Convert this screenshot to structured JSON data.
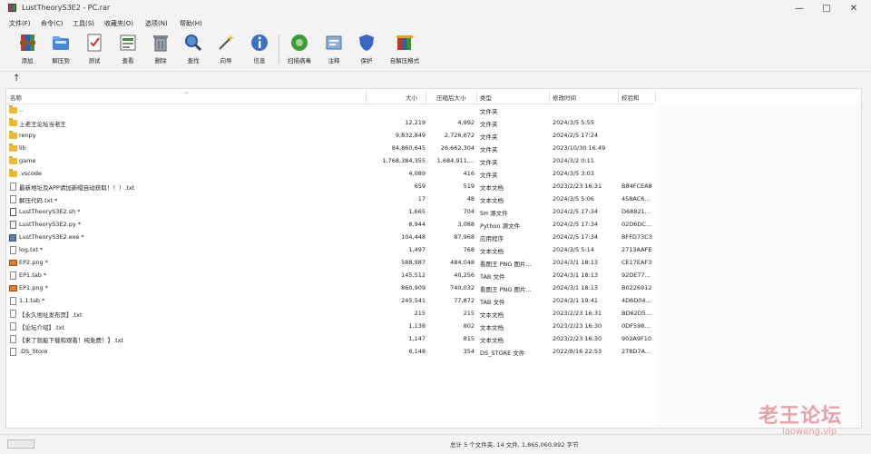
{
  "window": {
    "title": "LustTheoryS3E2 - PC.rar",
    "minimize": "—",
    "maximize": "□",
    "close": "✕"
  },
  "menu": [
    "文件(F)",
    "命令(C)",
    "工具(S)",
    "收藏夹(O)",
    "选项(N)",
    "帮助(H)"
  ],
  "toolbar": [
    {
      "label": "添加",
      "icon": "add-archive-icon"
    },
    {
      "label": "解压到",
      "icon": "extract-to-icon"
    },
    {
      "label": "测试",
      "icon": "test-icon"
    },
    {
      "label": "查看",
      "icon": "view-icon"
    },
    {
      "label": "删除",
      "icon": "delete-icon"
    },
    {
      "label": "查找",
      "icon": "find-icon"
    },
    {
      "label": "向导",
      "icon": "wizard-icon"
    },
    {
      "label": "信息",
      "icon": "info-icon"
    },
    {
      "label": "扫描病毒",
      "icon": "scan-virus-icon"
    },
    {
      "label": "注释",
      "icon": "comment-icon"
    },
    {
      "label": "保护",
      "icon": "protect-icon"
    },
    {
      "label": "自解压格式",
      "icon": "sfx-icon"
    }
  ],
  "address": {
    "up": "↑"
  },
  "columns": {
    "name": "名称",
    "size": "大小",
    "packed": "压缩后大小",
    "type": "类型",
    "modified": "修改时间",
    "crc": "校验和"
  },
  "files": [
    {
      "name": "..",
      "size": "",
      "packed": "",
      "type": "文件夹",
      "modified": "",
      "crc": "",
      "icon": "folder"
    },
    {
      "name": "上老王论坛当老王",
      "size": "12,219",
      "packed": "4,992",
      "type": "文件夹",
      "modified": "2024/3/5 5:55",
      "crc": "",
      "icon": "folder"
    },
    {
      "name": "renpy",
      "size": "9,832,849",
      "packed": "2,726,672",
      "type": "文件夹",
      "modified": "2024/2/5 17:24",
      "crc": "",
      "icon": "folder"
    },
    {
      "name": "lib",
      "size": "84,860,645",
      "packed": "26,662,304",
      "type": "文件夹",
      "modified": "2023/10/30 16:49",
      "crc": "",
      "icon": "folder"
    },
    {
      "name": "game",
      "size": "1,768,384,355",
      "packed": "1,684,911,...",
      "type": "文件夹",
      "modified": "2024/3/2 0:11",
      "crc": "",
      "icon": "folder"
    },
    {
      "name": ".vscode",
      "size": "4,089",
      "packed": "416",
      "type": "文件夹",
      "modified": "2024/3/5 3:03",
      "crc": "",
      "icon": "folder"
    },
    {
      "name": "最新地址及APP请加新帽自动获取！！！.txt",
      "size": "659",
      "packed": "519",
      "type": "文本文档",
      "modified": "2023/2/23 16:31",
      "crc": "B84FCEA8",
      "icon": "doc"
    },
    {
      "name": "解压代码.txt *",
      "size": "17",
      "packed": "48",
      "type": "文本文档",
      "modified": "2024/3/5 5:06",
      "crc": "458AC6...",
      "icon": "doc"
    },
    {
      "name": "LustTheoryS3E2.sh *",
      "size": "1,665",
      "packed": "704",
      "type": "SH 源文件",
      "modified": "2024/2/5 17:34",
      "crc": "D68821...",
      "icon": "script"
    },
    {
      "name": "LustTheoryS3E2.py *",
      "size": "8,944",
      "packed": "3,088",
      "type": "Python 源文件",
      "modified": "2024/2/5 17:34",
      "crc": "02D6DC...",
      "icon": "py"
    },
    {
      "name": "LustTheoryS3E2.exe *",
      "size": "104,448",
      "packed": "87,968",
      "type": "应用程序",
      "modified": "2024/2/5 17:34",
      "crc": "BFFD73C3",
      "icon": "exe"
    },
    {
      "name": "log.txt *",
      "size": "1,497",
      "packed": "768",
      "type": "文本文档",
      "modified": "2024/3/5 5:14",
      "crc": "2713AAFE",
      "icon": "doc"
    },
    {
      "name": "EP2.png *",
      "size": "588,987",
      "packed": "484,048",
      "type": "看图王 PNG 图片...",
      "modified": "2024/3/1 18:13",
      "crc": "CE17EAF3",
      "icon": "img"
    },
    {
      "name": "EP1.tab *",
      "size": "145,512",
      "packed": "40,256",
      "type": "TAB 文件",
      "modified": "2024/3/1 18:13",
      "crc": "92DE77...",
      "icon": "doc"
    },
    {
      "name": "EP1.png *",
      "size": "860,909",
      "packed": "740,032",
      "type": "看图王 PNG 图片...",
      "modified": "2024/3/1 18:13",
      "crc": "B0226912",
      "icon": "img"
    },
    {
      "name": "1.1.tab *",
      "size": "245,541",
      "packed": "77,872",
      "type": "TAB 文件",
      "modified": "2024/3/1 19:41",
      "crc": "4D6D04...",
      "icon": "doc"
    },
    {
      "name": "【永久地址发布页】.txt",
      "size": "215",
      "packed": "215",
      "type": "文本文档",
      "modified": "2023/2/23 16:31",
      "crc": "BD62D5...",
      "icon": "doc"
    },
    {
      "name": "【论坛介绍】.txt",
      "size": "1,138",
      "packed": "802",
      "type": "文本文档",
      "modified": "2023/2/23 16:30",
      "crc": "0DF598...",
      "icon": "doc"
    },
    {
      "name": "【来了就能下载和观看！纯免费！】.txt",
      "size": "1,147",
      "packed": "815",
      "type": "文本文档",
      "modified": "2023/2/23 16:30",
      "crc": "902A9F10",
      "icon": "doc"
    },
    {
      "name": ".DS_Store",
      "size": "6,148",
      "packed": "354",
      "type": "DS_STORE 文件",
      "modified": "2022/8/16 22:53",
      "crc": "278D7A...",
      "icon": "doc"
    }
  ],
  "status": "总计 5 个文件夹, 14 文件, 1,865,060,992 字节",
  "watermark": {
    "title": "老王论坛",
    "url": "laowang.vip"
  }
}
